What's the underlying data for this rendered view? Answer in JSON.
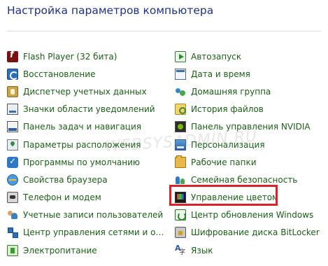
{
  "header": {
    "title": "Настройка параметров компьютера"
  },
  "watermark": "WEBSYSADMIN.RU",
  "left_items": [
    {
      "label": "Flash Player (32 бита)",
      "icon": "flash-player-icon"
    },
    {
      "label": "Восстановление",
      "icon": "recovery-icon"
    },
    {
      "label": "Диспетчер учетных данных",
      "icon": "credential-manager-icon"
    },
    {
      "label": "Значки области уведомлений",
      "icon": "notification-area-icon"
    },
    {
      "label": "Панель задач и навигация",
      "icon": "taskbar-icon"
    },
    {
      "label": "Параметры расположения",
      "icon": "location-icon"
    },
    {
      "label": "Программы по умолчанию",
      "icon": "default-programs-icon"
    },
    {
      "label": "Свойства браузера",
      "icon": "browser-icon"
    },
    {
      "label": "Телефон и модем",
      "icon": "phone-modem-icon"
    },
    {
      "label": "Учетные записи пользователей",
      "icon": "user-accounts-icon"
    },
    {
      "label": "Центр управления сетями и общи...",
      "icon": "network-center-icon"
    },
    {
      "label": "Электропитание",
      "icon": "power-options-icon"
    }
  ],
  "right_items": [
    {
      "label": "Автозапуск",
      "icon": "autoplay-icon"
    },
    {
      "label": "Дата и время",
      "icon": "date-time-icon"
    },
    {
      "label": "Домашняя группа",
      "icon": "homegroup-icon"
    },
    {
      "label": "История файлов",
      "icon": "file-history-icon"
    },
    {
      "label": "Панель управления NVIDIA",
      "icon": "nvidia-icon"
    },
    {
      "label": "Персонализация",
      "icon": "personalization-icon"
    },
    {
      "label": "Рабочие папки",
      "icon": "work-folders-icon"
    },
    {
      "label": "Семейная безопасность",
      "icon": "family-safety-icon"
    },
    {
      "label": "Управление цветом",
      "icon": "color-management-icon"
    },
    {
      "label": "Центр обновления Windows",
      "icon": "windows-update-icon"
    },
    {
      "label": "Шифрование диска BitLocker",
      "icon": "bitlocker-icon"
    },
    {
      "label": "Язык",
      "icon": "language-icon"
    }
  ],
  "colors": {
    "title": "#1e3287",
    "link": "#1c6018",
    "highlight_border": "#d8232a"
  }
}
